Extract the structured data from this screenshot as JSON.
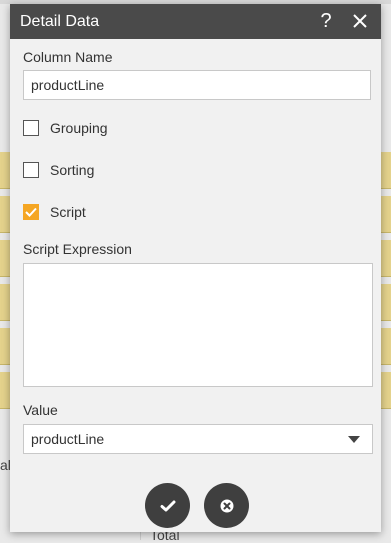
{
  "background": {
    "left_text": "al",
    "bottom_text": "Total"
  },
  "dialog": {
    "title": "Detail Data",
    "help_icon": "help-icon",
    "close_icon": "close-icon",
    "column_name_label": "Column Name",
    "column_name_value": "productLine",
    "checkboxes": [
      {
        "label": "Grouping",
        "checked": false
      },
      {
        "label": "Sorting",
        "checked": false
      },
      {
        "label": "Script",
        "checked": true
      }
    ],
    "script_expression_label": "Script Expression",
    "script_expression_value": "",
    "value_label": "Value",
    "value_selected": "productLine",
    "confirm_icon": "checkmark-icon",
    "cancel_icon": "cancel-icon",
    "colors": {
      "titlebar": "#4a4a4a",
      "accent": "#f5a623",
      "button": "#3f3f3f"
    }
  }
}
